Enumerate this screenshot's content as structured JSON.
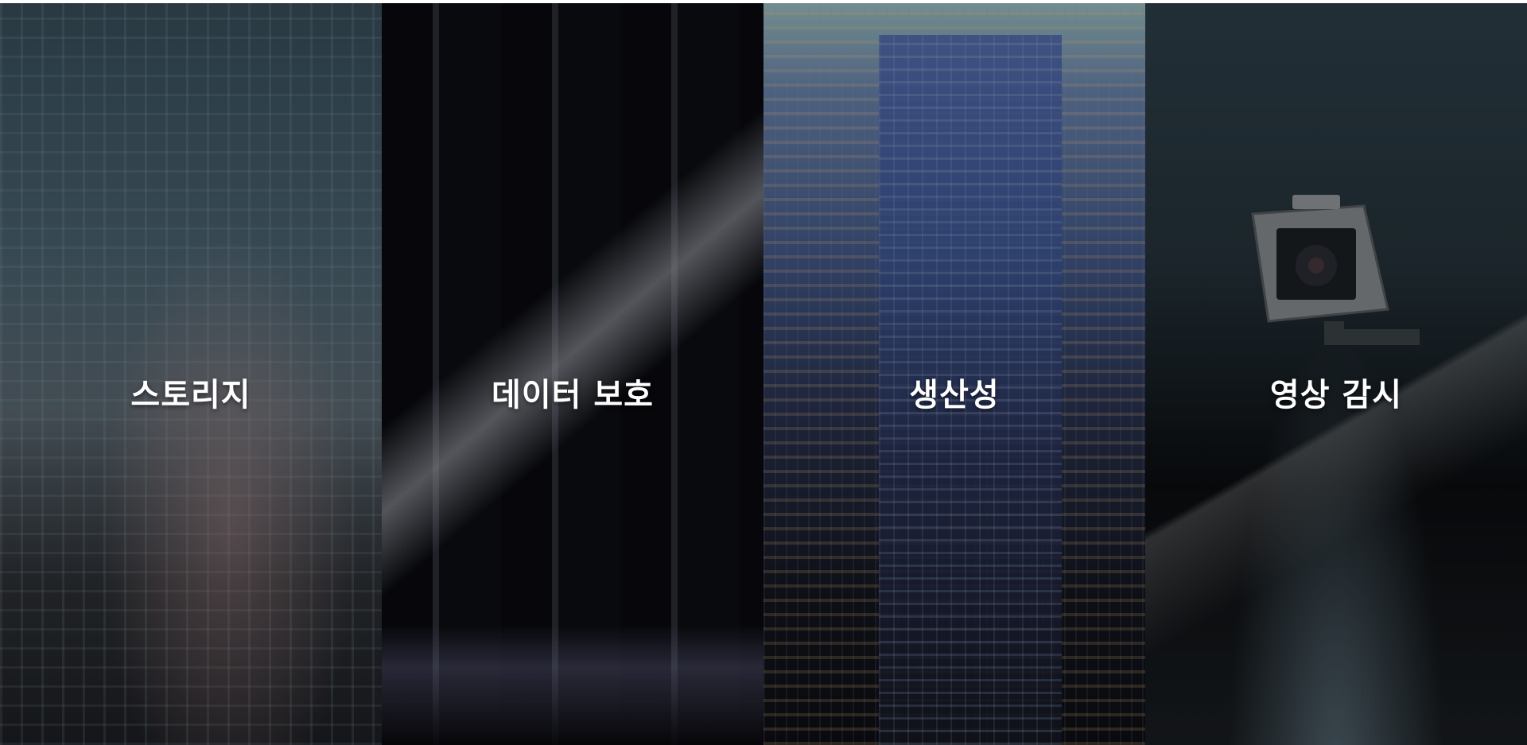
{
  "panels": [
    {
      "id": "storage",
      "label": "스토리지"
    },
    {
      "id": "data-protection",
      "label": "데이터 보호"
    },
    {
      "id": "productivity",
      "label": "생산성"
    },
    {
      "id": "video-surveillance",
      "label": "영상 감시"
    }
  ],
  "colors": {
    "label_text": "#ffffff",
    "page_background": "#ffffff"
  }
}
